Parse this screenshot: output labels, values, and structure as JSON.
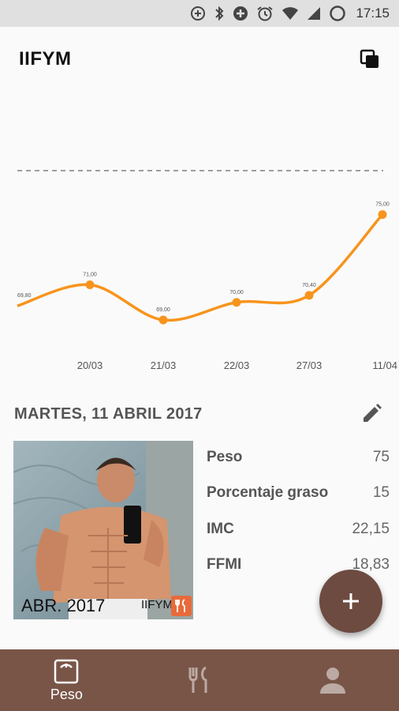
{
  "status_bar": {
    "time": "17:15",
    "icons": [
      "data-saver-icon",
      "bluetooth-icon",
      "add-circle-icon",
      "alarm-icon",
      "wifi-icon",
      "signal-icon",
      "battery-icon"
    ]
  },
  "app_bar": {
    "title": "IIFYM",
    "action_icon": "copy-icon"
  },
  "chart_data": {
    "type": "line",
    "x": [
      "",
      "20/03",
      "21/03",
      "22/03",
      "27/03",
      "11/04"
    ],
    "xtick_labels": [
      "20/03",
      "21/03",
      "22/03",
      "27/03",
      "11/04"
    ],
    "values": [
      69.8,
      71.0,
      69.0,
      70.0,
      70.4,
      75.0
    ],
    "data_labels": [
      "69,80",
      "71,00",
      "69,00",
      "70,00",
      "70,40",
      "75,00"
    ],
    "target_line": 77.5,
    "line_color": "#f7941d",
    "target_line_color": "#9e9e9e",
    "title": "",
    "xlabel": "",
    "ylabel": ""
  },
  "day": {
    "date": "MARTES, 11  ABRIL 2017",
    "edit_icon": "pencil-icon"
  },
  "photo": {
    "caption": "ABR. 2017",
    "brand": "IIFYM"
  },
  "stats": [
    {
      "label": "Peso",
      "value": "75"
    },
    {
      "label": "Porcentaje graso",
      "value": "15"
    },
    {
      "label": "IMC",
      "value": "22,15"
    },
    {
      "label": "FFMI",
      "value": "18,83"
    }
  ],
  "fab": {
    "icon": "plus-icon"
  },
  "bottom_nav": {
    "items": [
      {
        "label": "Peso",
        "icon": "scale-icon",
        "active": true
      },
      {
        "label": "",
        "icon": "fork-knife-icon",
        "active": false
      },
      {
        "label": "",
        "icon": "person-icon",
        "active": false
      }
    ]
  },
  "colors": {
    "primary": "#795548",
    "fab": "#6d4b40",
    "accent": "#f7941d"
  }
}
